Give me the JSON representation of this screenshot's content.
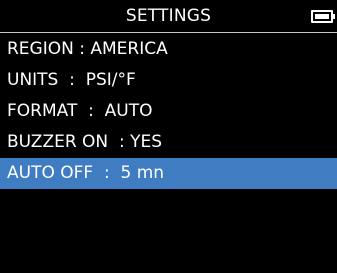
{
  "header": {
    "title": "SETTINGS",
    "battery_icon": "battery-full-icon"
  },
  "colors": {
    "background": "#000000",
    "text": "#ffffff",
    "selection": "#3f7cc1"
  },
  "menu": {
    "selected_index": 4,
    "items": [
      {
        "label": "REGION : AMERICA"
      },
      {
        "label": "UNITS  :  PSI/°F"
      },
      {
        "label": "FORMAT  :  AUTO"
      },
      {
        "label": "BUZZER ON  : YES"
      },
      {
        "label": "AUTO OFF  :  5 mn"
      }
    ]
  }
}
